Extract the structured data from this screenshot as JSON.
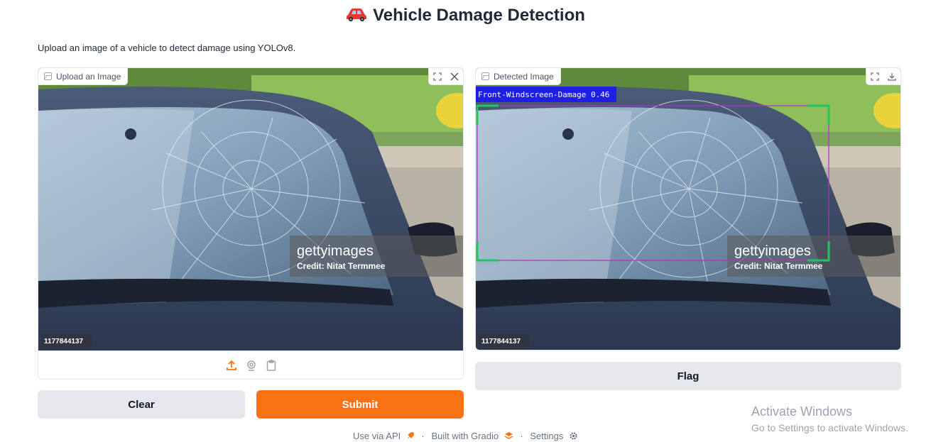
{
  "header": {
    "title": "Vehicle Damage Detection",
    "description": "Upload an image of a vehicle to detect damage using YOLOv8."
  },
  "input_panel": {
    "label": "Upload an Image",
    "watermark_brand": "gettyimages",
    "watermark_credit": "Credit: Nitat Termmee",
    "image_id": "1177844137"
  },
  "output_panel": {
    "label": "Detected Image",
    "detection_label": "Front-Windscreen-Damage 0.46",
    "watermark_brand": "gettyimages",
    "watermark_credit": "Credit: Nitat Termmee",
    "image_id": "1177844137"
  },
  "buttons": {
    "clear": "Clear",
    "submit": "Submit",
    "flag": "Flag"
  },
  "footer": {
    "use_api": "Use via API",
    "built_with": "Built with Gradio",
    "settings": "Settings"
  },
  "os_overlay": {
    "line1": "Activate Windows",
    "line2": "Go to Settings to activate Windows."
  },
  "colors": {
    "accent": "#f97316",
    "detection_box": "#c026d3",
    "detection_label_bg": "#1e1ee6",
    "corner_marks": "#22c55e"
  },
  "icons": [
    "car-emoji-icon",
    "image-icon",
    "fullscreen-icon",
    "close-icon",
    "download-icon",
    "upload-icon",
    "webcam-icon",
    "clipboard-icon",
    "rocket-icon",
    "gradio-logo-icon",
    "gear-icon"
  ]
}
